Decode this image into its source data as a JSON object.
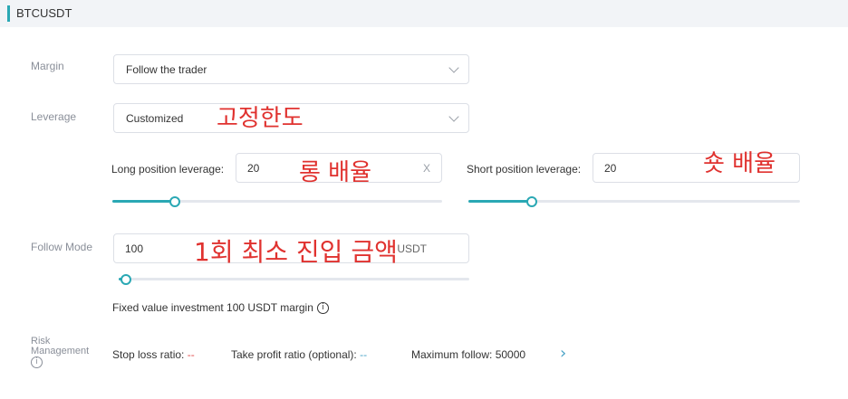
{
  "header": {
    "title": "BTCUSDT"
  },
  "margin": {
    "label": "Margin",
    "value": "Follow the trader"
  },
  "leverage": {
    "label": "Leverage",
    "value": "Customized",
    "long": {
      "label": "Long position leverage:",
      "value": "20",
      "clear": "X",
      "slider_fraction": 0.19
    },
    "short": {
      "label": "Short position leverage:",
      "value": "20",
      "slider_fraction": 0.19
    }
  },
  "follow_mode": {
    "label": "Follow Mode",
    "value": "100",
    "unit": "USDT",
    "slider_fraction": 0.02,
    "note": "Fixed value investment 100 USDT margin",
    "note_icon": "i"
  },
  "risk": {
    "label_1": "Risk",
    "label_2": "Management",
    "label_icon": "i",
    "stop_loss_label": "Stop loss ratio:",
    "stop_loss_value": "--",
    "take_profit_label": "Take profit ratio (optional):",
    "take_profit_value": "--",
    "max_follow_label": "Maximum follow:",
    "max_follow_value": "50000",
    "arrow": "›"
  },
  "annotations": {
    "fixed_limit": "고정한도",
    "long_leverage": "롱 배율",
    "short_leverage": "숏 배율",
    "min_entry": "1회 최소 진입 금액"
  },
  "colors": {
    "accent": "#2aa8b4",
    "annotation": "#e0322f"
  }
}
